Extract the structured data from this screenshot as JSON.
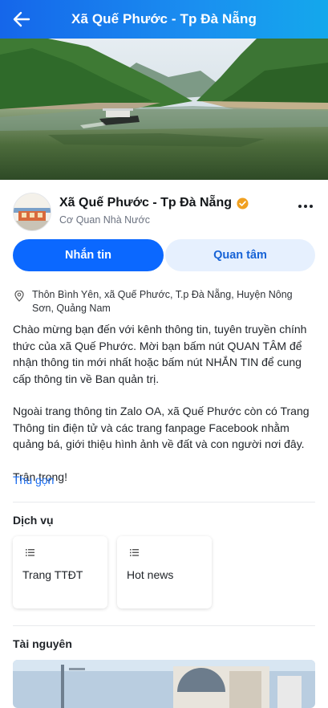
{
  "header": {
    "title": "Xã Quế Phước - Tp Đà Nẵng",
    "back_icon": "arrow-left-icon"
  },
  "profile": {
    "name": "Xã Quế Phước - Tp Đà Nẵng",
    "subtitle": "Cơ Quan Nhà Nước",
    "verified_icon": "verified-badge-icon",
    "more_icon": "more-dots-icon"
  },
  "actions": {
    "message_label": "Nhắn tin",
    "follow_label": "Quan tâm"
  },
  "address": {
    "icon": "location-pin-icon",
    "text": "Thôn Bình Yên, xã Quế Phước, T.p Đà Nẵng, Huyện Nông Sơn, Quảng Nam"
  },
  "description": {
    "paragraphs": [
      "Chào mừng bạn đến với kênh thông tin, tuyên truyền chính thức của xã Quế Phước. Mời bạn bấm nút QUAN TÂM để nhận thông tin mới nhất hoặc bấm nút NHẮN TIN để cung cấp thông tin về Ban quản trị.",
      "Ngoài trang thông tin Zalo OA, xã Quế Phước còn có Trang Thông tin điện tử và các trang fanpage Facebook nhằm quảng bá, giới thiệu hình ảnh về đất và con người nơi đây.",
      "Trân trọng!"
    ],
    "collapse_label": "Thu gọn"
  },
  "services": {
    "title": "Dịch vụ",
    "items": [
      {
        "label": "Trang TTĐT",
        "icon": "list-icon"
      },
      {
        "label": "Hot news",
        "icon": "list-icon"
      }
    ]
  },
  "resources": {
    "title": "Tài nguyên"
  },
  "colors": {
    "primary": "#0b68ff",
    "secondary_bg": "#e6f0fe",
    "link": "#1a6df2",
    "verified": "#f0a020"
  }
}
